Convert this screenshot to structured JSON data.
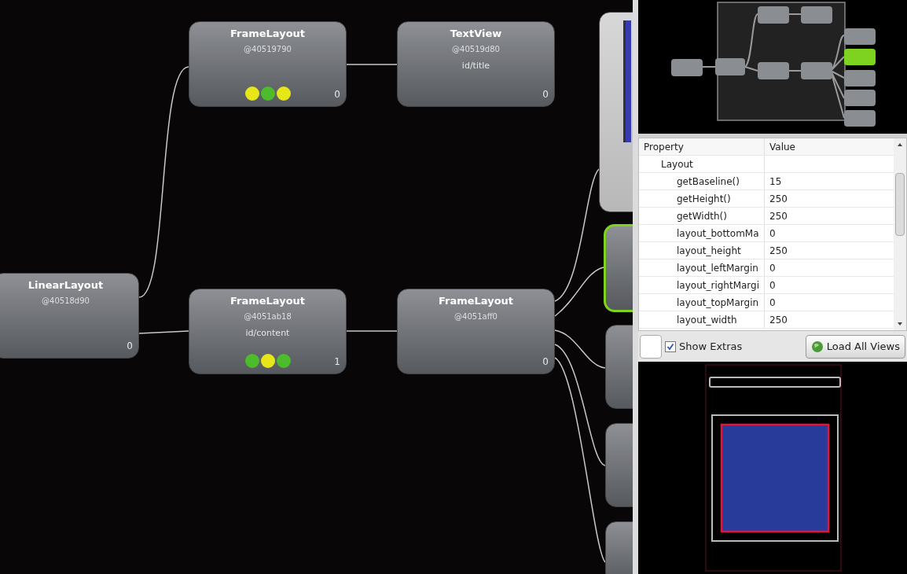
{
  "nodes": [
    {
      "title": "LinearLayout",
      "address": "@40518d90",
      "count": "0"
    },
    {
      "title": "FrameLayout",
      "address": "@40519790",
      "count": "0",
      "indicators": [
        {
          "color": "#e6e619"
        },
        {
          "color": "#4cbb2c"
        },
        {
          "color": "#e6e619"
        }
      ]
    },
    {
      "title": "TextView",
      "address": "@40519d80",
      "resource_id": "id/title",
      "count": "0"
    },
    {
      "title": "FrameLayout",
      "address": "@4051ab18",
      "resource_id": "id/content",
      "count": "1",
      "indicators": [
        {
          "color": "#4cbb2c"
        },
        {
          "color": "#e6e619"
        },
        {
          "color": "#4cbb2c"
        }
      ]
    },
    {
      "title": "FrameLayout",
      "address": "@4051aff0",
      "count": "0"
    }
  ],
  "child_nodes": [
    {
      "selected": false
    },
    {
      "selected": true
    },
    {
      "selected": false
    },
    {
      "selected": false
    },
    {
      "selected": false
    }
  ],
  "properties": {
    "columns": [
      "Property",
      "Value"
    ],
    "groups": [
      {
        "name": "Layout",
        "children": [
          {
            "name": "getBaseline()",
            "value": "15"
          },
          {
            "name": "getHeight()",
            "value": "250"
          },
          {
            "name": "getWidth()",
            "value": "250"
          },
          {
            "name": "layout_bottomMa",
            "value": "0"
          },
          {
            "name": "layout_height",
            "value": "250"
          },
          {
            "name": "layout_leftMargin",
            "value": "0"
          },
          {
            "name": "layout_rightMargi",
            "value": "0"
          },
          {
            "name": "layout_topMargin",
            "value": "0"
          },
          {
            "name": "layout_width",
            "value": "250"
          }
        ]
      }
    ]
  },
  "show_extras": {
    "label": "Show Extras",
    "checked": true
  },
  "load_button": {
    "label": "Load All Views"
  }
}
